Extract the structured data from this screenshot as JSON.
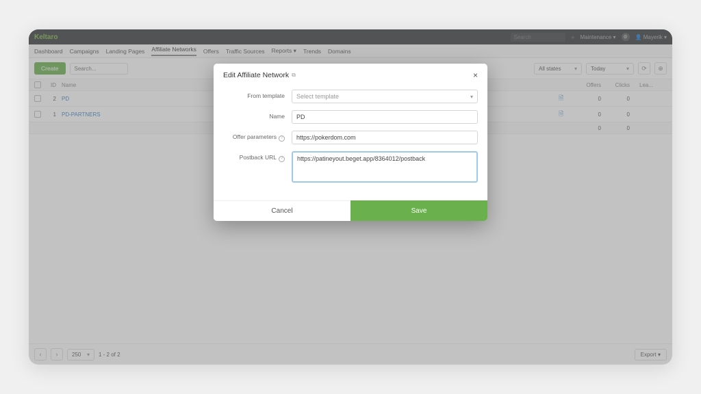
{
  "topbar": {
    "logo": "Keltaro",
    "search_placeholder": "Search",
    "maintenance": "Maintenance ▾",
    "user": "Mayerik ▾"
  },
  "menu": {
    "items": [
      "Dashboard",
      "Campaigns",
      "Landing Pages",
      "Affiliate Networks",
      "Offers",
      "Traffic Sources",
      "Reports ▾",
      "Trends",
      "Domains"
    ],
    "active_index": 3
  },
  "toolbar": {
    "create": "Create",
    "search_placeholder": "Search...",
    "states_label": "All states",
    "date_label": "Today"
  },
  "table": {
    "headers": {
      "id": "ID",
      "name": "Name",
      "offers": "Offers",
      "clicks": "Clicks",
      "rest": "Lea..."
    },
    "rows": [
      {
        "id": "2",
        "name": "PD",
        "offers": "0",
        "clicks": "0"
      },
      {
        "id": "1",
        "name": "PD-PARTNERS",
        "offers": "0",
        "clicks": "0"
      }
    ],
    "totals": {
      "offers": "0",
      "clicks": "0"
    }
  },
  "footer": {
    "page_size": "250",
    "range": "1 - 2 of 2",
    "export": "Export ▾"
  },
  "modal": {
    "title": "Edit Affiliate Network",
    "labels": {
      "template": "From template",
      "name": "Name",
      "offer_params": "Offer parameters",
      "postback": "Postback URL"
    },
    "template_placeholder": "Select template",
    "name_value": "PD",
    "offer_params_value": "https://pokerdom.com",
    "postback_value": "https://patineyout.beget.app/8364012/postback",
    "cancel": "Cancel",
    "save": "Save"
  }
}
